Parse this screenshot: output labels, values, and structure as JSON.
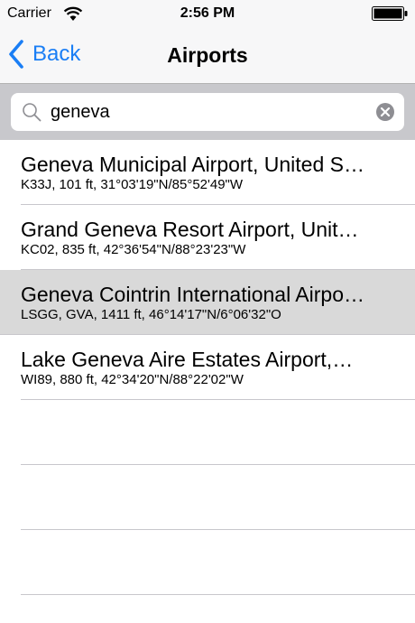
{
  "status_bar": {
    "carrier": "Carrier",
    "time": "2:56 PM",
    "wifi_icon": "wifi-icon",
    "battery_icon": "battery-icon"
  },
  "nav": {
    "back_label": "Back",
    "title": "Airports",
    "accent_color": "#1a7ef5"
  },
  "search": {
    "value": "geneva",
    "icon": "search-icon",
    "clear_icon": "clear-icon"
  },
  "airports": [
    {
      "name": "Geneva Municipal Airport, United S…",
      "details": "K33J, 101 ft, 31°03'19\"N/85°52'49\"W",
      "selected": false
    },
    {
      "name": "Grand Geneva Resort Airport, Unit…",
      "details": "KC02, 835 ft, 42°36'54\"N/88°23'23\"W",
      "selected": false
    },
    {
      "name": "Geneva Cointrin International Airpo…",
      "details": "LSGG, GVA, 1411 ft, 46°14'17\"N/6°06'32\"O",
      "selected": true
    },
    {
      "name": "Lake Geneva Aire Estates Airport,…",
      "details": "WI89, 880 ft, 42°34'20\"N/88°22'02\"W",
      "selected": false
    }
  ]
}
